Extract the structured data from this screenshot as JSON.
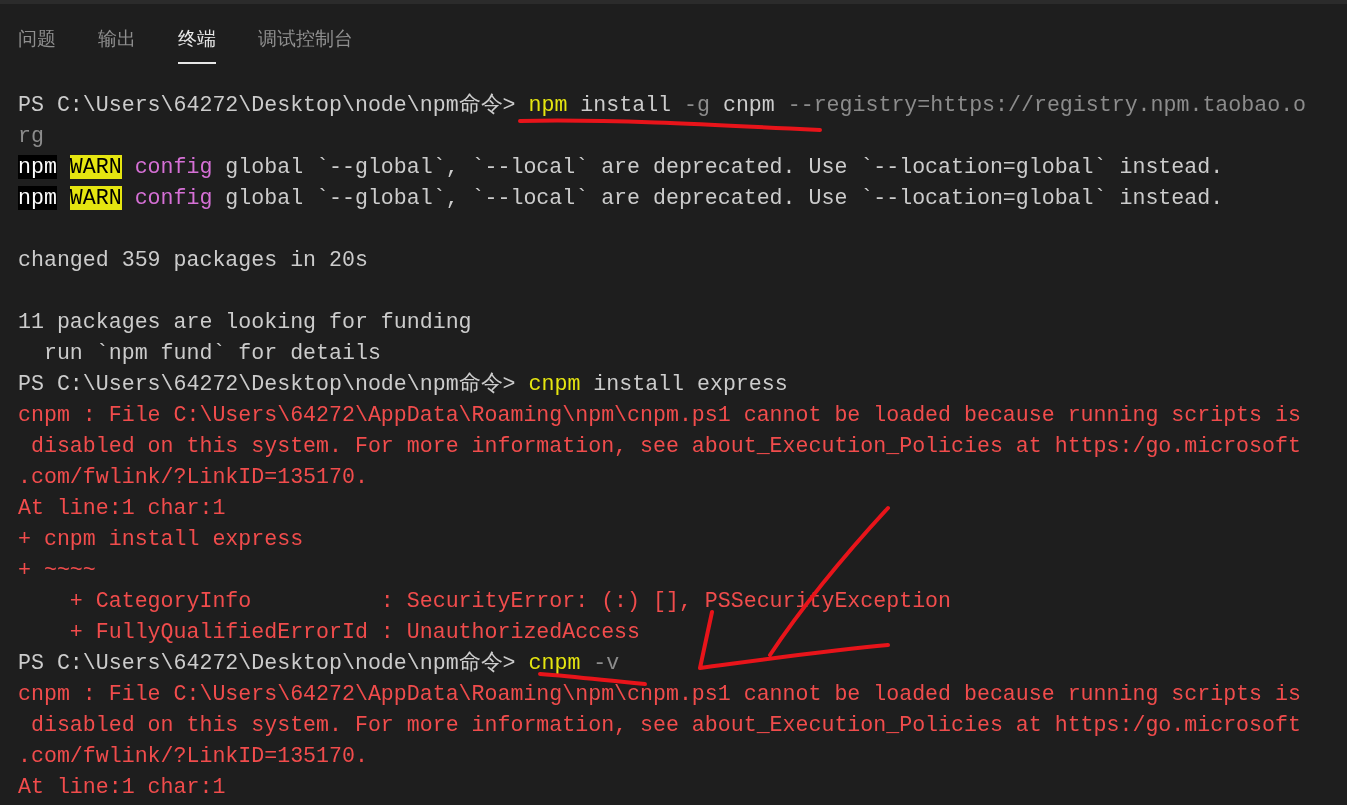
{
  "tabs": [
    {
      "label": "问题",
      "selected": false
    },
    {
      "label": "输出",
      "selected": false
    },
    {
      "label": "终端",
      "selected": true
    },
    {
      "label": "调试控制台",
      "selected": false
    }
  ],
  "terminal": {
    "lines": [
      [
        {
          "kind": "prompt",
          "text": "PS C:\\Users\\64272\\Desktop\\node\\npm命令> "
        },
        {
          "kind": "command",
          "text": "npm"
        },
        {
          "kind": "plain",
          "text": " install "
        },
        {
          "kind": "flag",
          "text": "-g"
        },
        {
          "kind": "plain",
          "text": " cnpm "
        },
        {
          "kind": "flag",
          "text": "--registry=https://registry.npm.taobao.o"
        }
      ],
      [
        {
          "kind": "flag",
          "text": "rg"
        }
      ],
      [
        {
          "kind": "npm-tag",
          "text": "npm"
        },
        {
          "kind": "warn-tag",
          "text": "WARN"
        },
        {
          "kind": "config",
          "text": "config"
        },
        {
          "kind": "plain",
          "text": " global `--global`, `--local` are deprecated. Use `--location=global` instead."
        }
      ],
      [
        {
          "kind": "npm-tag",
          "text": "npm"
        },
        {
          "kind": "warn-tag",
          "text": "WARN"
        },
        {
          "kind": "config",
          "text": "config"
        },
        {
          "kind": "plain",
          "text": " global `--global`, `--local` are deprecated. Use `--location=global` instead."
        }
      ],
      [
        {
          "kind": "plain",
          "blank_before": true,
          "text": "changed 359 packages in 20s"
        }
      ],
      [
        {
          "kind": "plain",
          "blank_before": true,
          "text": "11 packages are looking for funding"
        }
      ],
      [
        {
          "kind": "plain",
          "text": "  run `npm fund` for details"
        }
      ],
      [
        {
          "kind": "prompt",
          "text": "PS C:\\Users\\64272\\Desktop\\node\\npm命令> "
        },
        {
          "kind": "command",
          "text": "cnpm"
        },
        {
          "kind": "plain",
          "text": " install express"
        }
      ],
      [
        {
          "kind": "error",
          "text": "cnpm : File C:\\Users\\64272\\AppData\\Roaming\\npm\\cnpm.ps1 cannot be loaded because running scripts is"
        }
      ],
      [
        {
          "kind": "error",
          "text": " disabled on this system. For more information, see about_Execution_Policies at https:/go.microsoft"
        }
      ],
      [
        {
          "kind": "error",
          "text": ".com/fwlink/?LinkID=135170."
        }
      ],
      [
        {
          "kind": "error",
          "text": "At line:1 char:1"
        }
      ],
      [
        {
          "kind": "error",
          "text": "+ cnpm install express"
        }
      ],
      [
        {
          "kind": "error",
          "text": "+ ~~~~"
        }
      ],
      [
        {
          "kind": "error",
          "text": "    + CategoryInfo          : SecurityError: (:) [], PSSecurityException"
        }
      ],
      [
        {
          "kind": "error",
          "text": "    + FullyQualifiedErrorId : UnauthorizedAccess"
        }
      ],
      [
        {
          "kind": "prompt",
          "text": "PS C:\\Users\\64272\\Desktop\\node\\npm命令> "
        },
        {
          "kind": "command",
          "text": "cnpm"
        },
        {
          "kind": "flag",
          "text": " -v"
        }
      ],
      [
        {
          "kind": "error",
          "text": "cnpm : File C:\\Users\\64272\\AppData\\Roaming\\npm\\cnpm.ps1 cannot be loaded because running scripts is"
        }
      ],
      [
        {
          "kind": "error",
          "text": " disabled on this system. For more information, see about_Execution_Policies at https:/go.microsoft"
        }
      ],
      [
        {
          "kind": "error",
          "text": ".com/fwlink/?LinkID=135170."
        }
      ],
      [
        {
          "kind": "error",
          "text": "At line:1 char:1"
        }
      ]
    ]
  }
}
